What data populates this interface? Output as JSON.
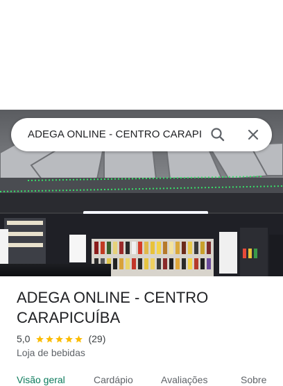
{
  "search": {
    "query": "ADEGA ONLINE - CENTRO CARAPIC"
  },
  "place": {
    "name": "ADEGA ONLINE - CENTRO CARAPICUÍBA",
    "rating": "5,0",
    "rating_value": 5,
    "rating_max": 5,
    "reviews": "(29)",
    "category": "Loja de bebidas"
  },
  "tabs": [
    {
      "label": "Visão geral",
      "active": true
    },
    {
      "label": "Cardápio",
      "active": false
    },
    {
      "label": "Avaliações",
      "active": false
    },
    {
      "label": "Sobre",
      "active": false
    }
  ],
  "icons": {
    "search": "search-icon",
    "close": "close-icon",
    "star": "star-icon"
  },
  "colors": {
    "star": "#fbbc04",
    "active_tab": "#0b7a5b"
  }
}
